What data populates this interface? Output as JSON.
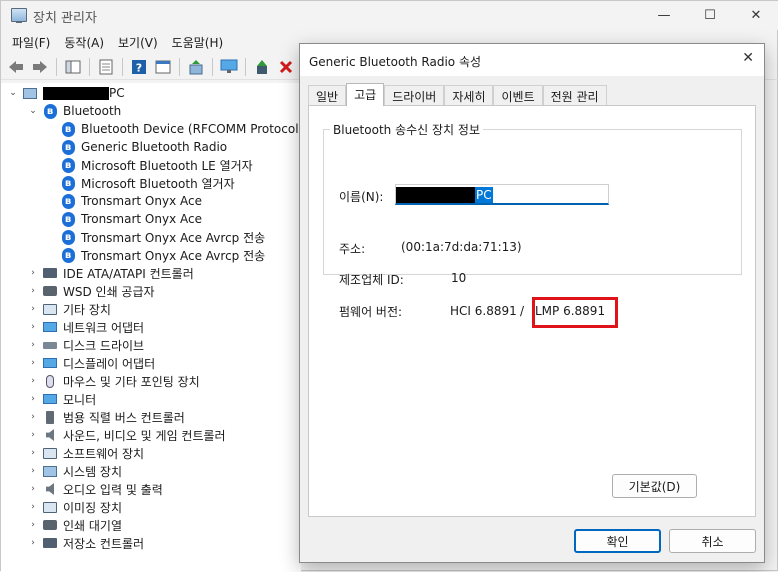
{
  "window": {
    "title": "장치 관리자"
  },
  "menu": [
    "파일(F)",
    "동작(A)",
    "보기(V)",
    "도움말(H)"
  ],
  "tree": {
    "root_suffix": "PC",
    "bluetooth": {
      "label": "Bluetooth",
      "children": [
        "Bluetooth Device (RFCOMM Protocol TDI)",
        "Generic Bluetooth Radio",
        "Microsoft Bluetooth LE 열거자",
        "Microsoft Bluetooth 열거자",
        "Tronsmart Onyx Ace",
        "Tronsmart Onyx Ace",
        "Tronsmart Onyx Ace Avrcp 전송",
        "Tronsmart Onyx Ace Avrcp 전송"
      ]
    },
    "categories": [
      {
        "label": "IDE ATA/ATAPI 컨트롤러",
        "icon": "chip"
      },
      {
        "label": "WSD 인쇄 공급자",
        "icon": "printer"
      },
      {
        "label": "기타 장치",
        "icon": "dev"
      },
      {
        "label": "네트워크 어댑터",
        "icon": "monitor"
      },
      {
        "label": "디스크 드라이브",
        "icon": "drive"
      },
      {
        "label": "디스플레이 어댑터",
        "icon": "monitor"
      },
      {
        "label": "마우스 및 기타 포인팅 장치",
        "icon": "mouse"
      },
      {
        "label": "모니터",
        "icon": "monitor"
      },
      {
        "label": "범용 직렬 버스 컨트롤러",
        "icon": "usb"
      },
      {
        "label": "사운드, 비디오 및 게임 컨트롤러",
        "icon": "speaker"
      },
      {
        "label": "소프트웨어 장치",
        "icon": "dev"
      },
      {
        "label": "시스템 장치",
        "icon": "pc"
      },
      {
        "label": "오디오 입력 및 출력",
        "icon": "speaker"
      },
      {
        "label": "이미징 장치",
        "icon": "dev"
      },
      {
        "label": "인쇄 대기열",
        "icon": "printer"
      },
      {
        "label": "저장소 컨트롤러",
        "icon": "chip"
      }
    ]
  },
  "dialog": {
    "title": "Generic Bluetooth Radio 속성",
    "tabs": [
      "일반",
      "고급",
      "드라이버",
      "자세히",
      "이벤트",
      "전원 관리"
    ],
    "active_tab": "고급",
    "group_title": "Bluetooth 송수신 장치 정보",
    "name_label": "이름(N):",
    "name_value_suffix": "PC",
    "address_label": "주소:",
    "address_value": "(00:1a:7d:da:71:13)",
    "manufacturer_label": "제조업체 ID:",
    "manufacturer_value": "10",
    "firmware_label": "펌웨어 버전:",
    "hci_value": "HCI 6.8891",
    "separator": "/",
    "lmp_value": "LMP 6.8891",
    "default_button": "기본값(D)",
    "ok_button": "확인",
    "cancel_button": "취소",
    "highlight_color": "#e0131b"
  }
}
